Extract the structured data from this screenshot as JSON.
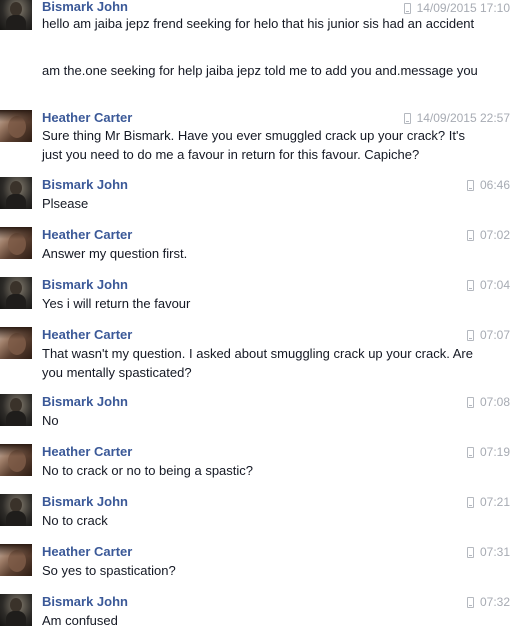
{
  "messages": [
    {
      "sender": "Bismark John",
      "avatar": "bismark-avatar",
      "timestamp": "14/09/2015 17:10",
      "paragraphs": [
        "hello am jaiba jepz frend seeking for helo that his junior sis had an accident",
        "am the.one seeking for help jaiba jepz told me to add you and.message you"
      ]
    },
    {
      "sender": "Heather Carter",
      "avatar": "heather-avatar",
      "timestamp": "14/09/2015 22:57",
      "paragraphs": [
        "Sure thing Mr Bismark. Have you ever smuggled crack up your crack? It's just you need to do me a favour in return for this favour. Capiche?"
      ]
    },
    {
      "sender": "Bismark John",
      "avatar": "bismark-avatar",
      "timestamp": "06:46",
      "paragraphs": [
        "Plsease"
      ]
    },
    {
      "sender": "Heather Carter",
      "avatar": "heather-avatar",
      "timestamp": "07:02",
      "paragraphs": [
        "Answer my question first."
      ]
    },
    {
      "sender": "Bismark John",
      "avatar": "bismark-avatar",
      "timestamp": "07:04",
      "paragraphs": [
        "Yes i will return the favour"
      ]
    },
    {
      "sender": "Heather Carter",
      "avatar": "heather-avatar",
      "timestamp": "07:07",
      "paragraphs": [
        "That wasn't my question. I asked about smuggling crack up your crack. Are you mentally spasticated?"
      ]
    },
    {
      "sender": "Bismark John",
      "avatar": "bismark-avatar",
      "timestamp": "07:08",
      "paragraphs": [
        "No"
      ]
    },
    {
      "sender": "Heather Carter",
      "avatar": "heather-avatar",
      "timestamp": "07:19",
      "paragraphs": [
        "No to crack or no to being a spastic?"
      ]
    },
    {
      "sender": "Bismark John",
      "avatar": "bismark-avatar",
      "timestamp": "07:21",
      "paragraphs": [
        "No to crack"
      ]
    },
    {
      "sender": "Heather Carter",
      "avatar": "heather-avatar",
      "timestamp": "07:31",
      "paragraphs": [
        "So yes to spastication?"
      ]
    },
    {
      "sender": "Bismark John",
      "avatar": "bismark-avatar",
      "timestamp": "07:32",
      "paragraphs": [
        "Am confused"
      ]
    }
  ]
}
